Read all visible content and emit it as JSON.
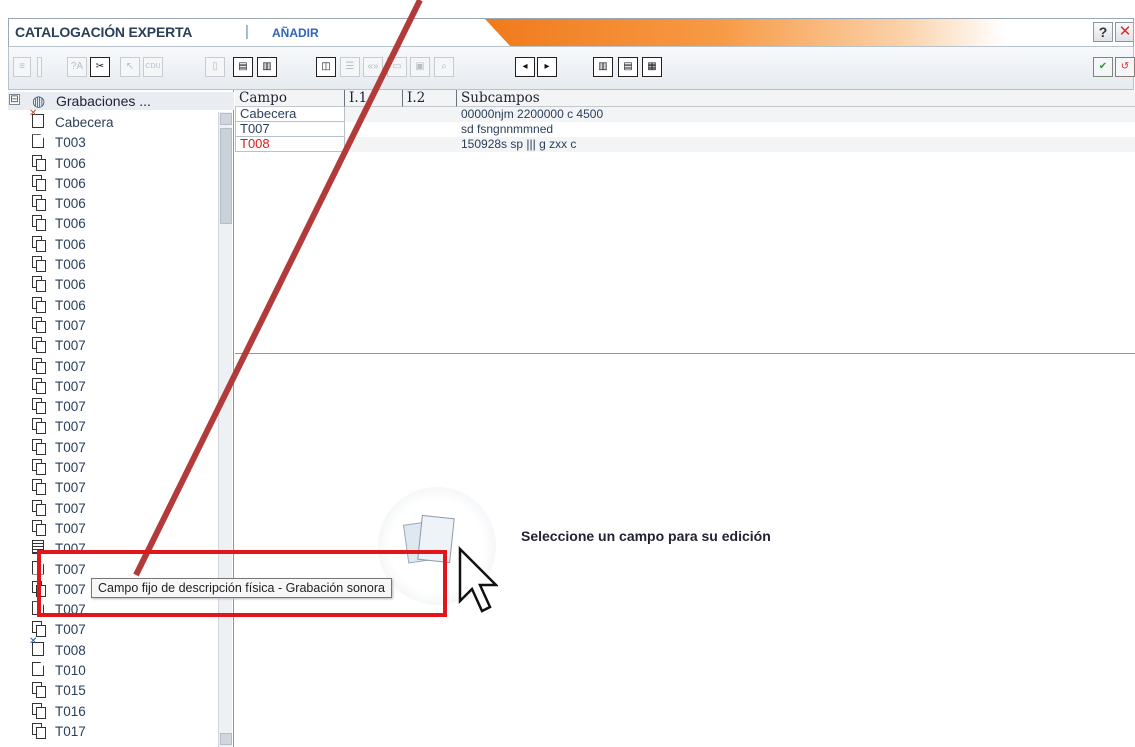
{
  "header": {
    "title": "CATALOGACIÓN EXPERTA",
    "separator": "|",
    "mode": "AÑADIR",
    "help": "?",
    "close": "✕"
  },
  "toolbar": {
    "icons": [
      "list-menu-icon",
      "field-help-icon",
      "split-icon",
      "cursor-tool-icon",
      "cdu-icon",
      "page-icon",
      "duplicate-icon",
      "duplicate-alt-icon",
      "preview-icon",
      "list-icon",
      "marc-icon",
      "tag-icon",
      "record-icon",
      "search-icon",
      "prev-icon",
      "next-icon",
      "layout-1-icon",
      "layout-2-icon",
      "layout-3-icon",
      "accept-icon",
      "cancel-icon"
    ],
    "labels": {
      "ta": "?A",
      "cdu": "CDU",
      "prev": "◂",
      "next": "▸",
      "accept": "✔",
      "cancel": "↺"
    }
  },
  "tree": {
    "root": "Grabaciones ...",
    "expander": "⊟",
    "items": [
      {
        "label": "Cabecera",
        "icon": "error-page-icon"
      },
      {
        "label": "T003",
        "icon": "page-icon"
      },
      {
        "label": "T006",
        "icon": "multi-page-icon"
      },
      {
        "label": "T006",
        "icon": "multi-page-icon"
      },
      {
        "label": "T006",
        "icon": "multi-page-icon"
      },
      {
        "label": "T006",
        "icon": "multi-page-icon"
      },
      {
        "label": "T006",
        "icon": "multi-page-icon"
      },
      {
        "label": "T006",
        "icon": "multi-page-icon"
      },
      {
        "label": "T006",
        "icon": "multi-page-icon"
      },
      {
        "label": "T006",
        "icon": "multi-page-icon"
      },
      {
        "label": "T007",
        "icon": "multi-page-icon"
      },
      {
        "label": "T007",
        "icon": "multi-page-icon"
      },
      {
        "label": "T007",
        "icon": "multi-page-icon"
      },
      {
        "label": "T007",
        "icon": "multi-page-icon"
      },
      {
        "label": "T007",
        "icon": "multi-page-icon"
      },
      {
        "label": "T007",
        "icon": "multi-page-icon"
      },
      {
        "label": "T007",
        "icon": "multi-page-icon"
      },
      {
        "label": "T007",
        "icon": "multi-page-icon"
      },
      {
        "label": "T007",
        "icon": "multi-page-icon"
      },
      {
        "label": "T007",
        "icon": "multi-page-icon"
      },
      {
        "label": "T007",
        "icon": "multi-page-icon"
      },
      {
        "label": "T007",
        "icon": "document-icon"
      },
      {
        "label": "T007",
        "icon": "page-icon"
      },
      {
        "label": "T007",
        "icon": "multi-page-icon"
      },
      {
        "label": "T007",
        "icon": "page-icon"
      },
      {
        "label": "T007",
        "icon": "multi-page-icon"
      },
      {
        "label": "T008",
        "icon": "error-page-icon"
      },
      {
        "label": "T010",
        "icon": "page-icon"
      },
      {
        "label": "T015",
        "icon": "multi-page-icon"
      },
      {
        "label": "T016",
        "icon": "multi-page-icon"
      },
      {
        "label": "T017",
        "icon": "multi-page-icon"
      }
    ]
  },
  "grid": {
    "headers": [
      "Campo",
      "I.1",
      "I.2",
      "Subcampos"
    ],
    "rows": [
      {
        "campo": "Cabecera",
        "subcampos": "00000njm 2200000 c 4500",
        "highlight": false
      },
      {
        "campo": "T007",
        "subcampos": "sd fsngnnmmned",
        "highlight": false
      },
      {
        "campo": "T008",
        "subcampos": "150928s sp ||| g zxx c",
        "highlight": true
      }
    ]
  },
  "editor": {
    "message": "Seleccione un campo para su edición"
  },
  "tooltip": {
    "text": "Campo fijo de descripción física  - Grabación sonora"
  },
  "annotation": {
    "box_color": "#e0161b",
    "arrow_color": "#b33a3a"
  }
}
